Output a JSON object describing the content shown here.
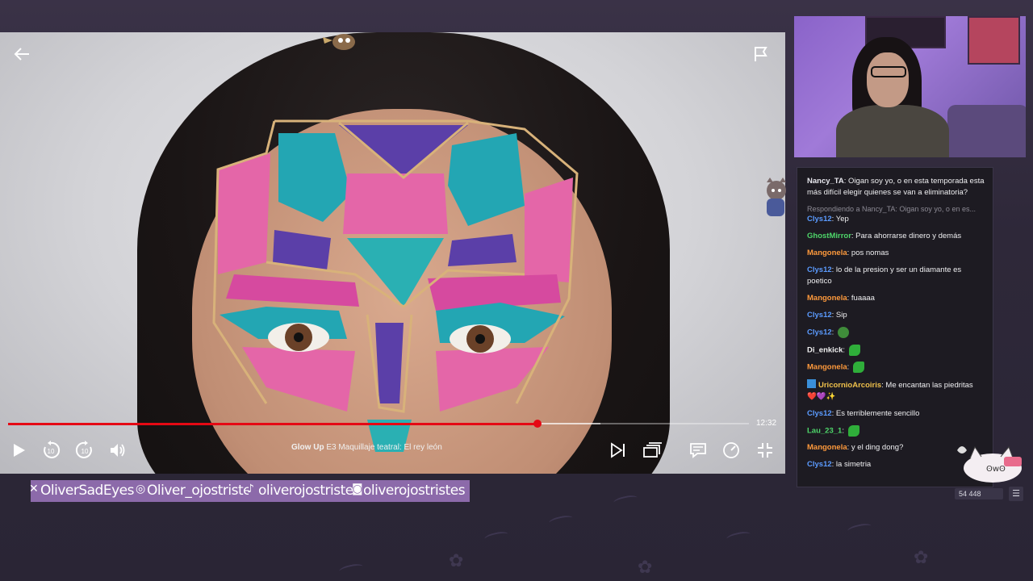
{
  "player": {
    "back_icon": "arrow-left-icon",
    "flag_icon": "flag-icon",
    "duration_text": "12:32",
    "progress_fraction": 0.715,
    "buffer_fraction": 0.8,
    "title_series": "Glow Up",
    "title_episode": "E3  Maquillaje teatral: El rey león",
    "controls": [
      "play-icon",
      "rewind-10-icon",
      "forward-10-icon",
      "volume-icon",
      "next-episode-icon",
      "episodes-icon",
      "subtitles-icon",
      "speed-icon",
      "exit-fullscreen-icon"
    ],
    "progress_color": "#e50914"
  },
  "chat": {
    "messages": [
      {
        "user": "Nancy_TA",
        "color": "#e8e8ee",
        "text": "Oigan soy yo, o en esta temporada esta más difícil elegir quienes se van a eliminatoria?"
      },
      {
        "reply": "Respondiendo a Nancy_TA: Oigan soy yo, o en es..."
      },
      {
        "user": "Clys12",
        "color": "#5b9bff",
        "text": "Yep"
      },
      {
        "user": "GhostMirror",
        "color": "#4ed66a",
        "text": "Para ahorrarse dinero y demás"
      },
      {
        "user": "Mangonela",
        "color": "#ff9a3c",
        "text": "pos nomas"
      },
      {
        "user": "Clys12",
        "color": "#5b9bff",
        "text": "lo de la presion y ser un diamante es poetico"
      },
      {
        "user": "Mangonela",
        "color": "#ff9a3c",
        "text": "fuaaaa"
      },
      {
        "user": "Clys12",
        "color": "#5b9bff",
        "text": "Sip"
      },
      {
        "user": "Clys12",
        "color": "#5b9bff",
        "text": "",
        "emote": "pepe-emote"
      },
      {
        "user": "Di_enkick",
        "color": "#f2f2f2",
        "text": "",
        "emote": "pickle-emote"
      },
      {
        "user": "Mangonela",
        "color": "#ff9a3c",
        "text": "",
        "emote": "pickle-emote"
      },
      {
        "user": "UricornioArcoiris",
        "color": "#f0c14b",
        "text": "Me encantan las piedritas ❤️💜✨",
        "badge": "badge-icon"
      },
      {
        "user": "Clys12",
        "color": "#5b9bff",
        "text": "Es terriblemente sencillo"
      },
      {
        "user": "Lau_23_1",
        "color": "#4ed66a",
        "text": "",
        "emote": "pickle-emote"
      },
      {
        "user": "Mangonela",
        "color": "#ff9a3c",
        "text": "y el ding dong?"
      },
      {
        "user": "Clys12",
        "color": "#5b9bff",
        "text": "la simetria"
      }
    ]
  },
  "viewer_count": "54 448",
  "socials": [
    {
      "icon": "x-icon",
      "handle": "OliverSadEyes"
    },
    {
      "icon": "instagram-icon",
      "handle": "Oliver_ojostristes_"
    },
    {
      "icon": "tiktok-icon",
      "handle": "oliverojostristes"
    },
    {
      "icon": "twitch-icon",
      "handle": "oliverojostristes"
    }
  ]
}
